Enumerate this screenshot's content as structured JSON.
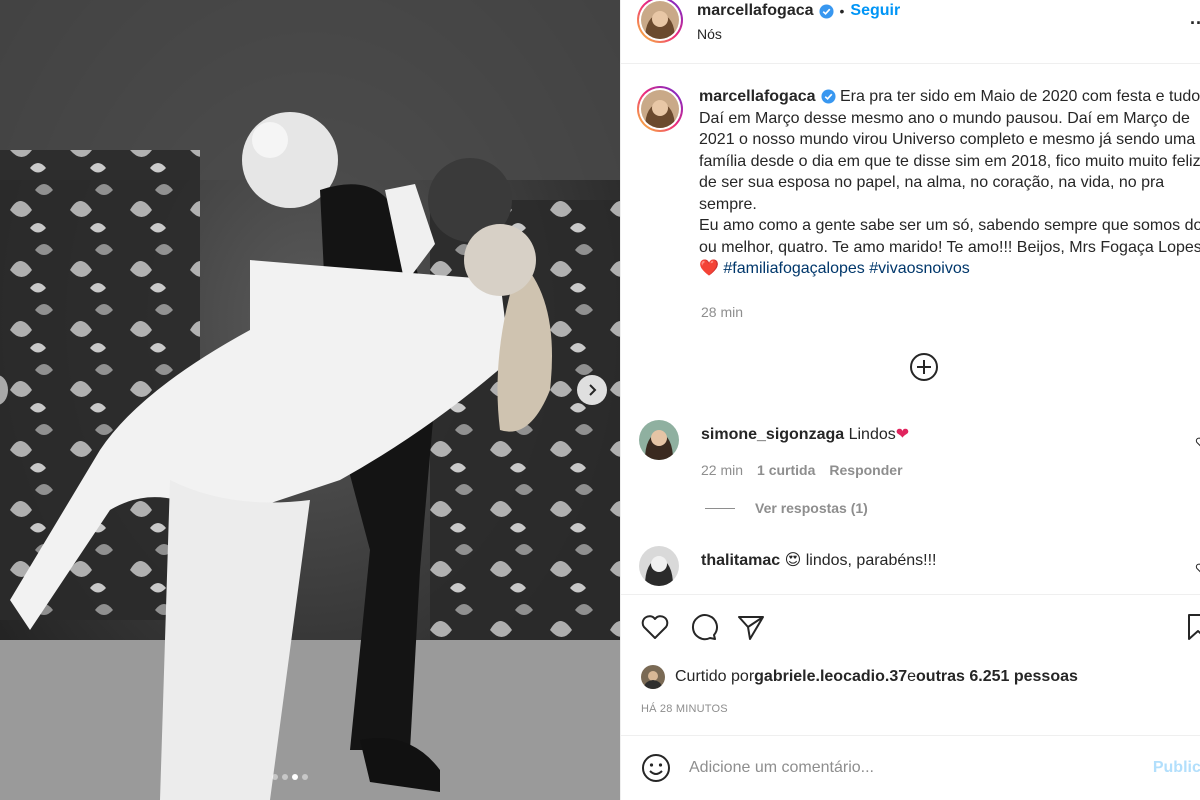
{
  "post": {
    "username": "marcellafogaca",
    "follow_label": "Seguir",
    "separator": "•",
    "location": "Nós",
    "more_label": "..."
  },
  "caption": {
    "username": "marcellafogaca",
    "text_part1": " Era pra ter sido em Maio de 2020 com festa e tudo. Daí em Março desse mesmo ano o mundo pausou. Daí em Março de 2021 o nosso mundo virou Universo completo e mesmo já sendo uma família desde o dia em que te disse sim em 2018, fico muito muito feliz de ser sua esposa no papel, na alma, no coração, na vida, no pra sempre.",
    "text_part2": "Eu amo como a gente sabe ser um só, sabendo sempre que somos dois, ou melhor, quatro. Te amo marido! Te amo!!! Beijos, Mrs Fogaça Lopes ",
    "heart": "❤️",
    "hashtag1": "#familiafogaçalopes",
    "hashtag2": "#vivaosnoivos",
    "time": "28 min"
  },
  "comments": [
    {
      "username": "simone_sigonzaga",
      "text": " Lindos",
      "emoji": "❤",
      "time": "22 min",
      "likes": "1 curtida",
      "reply": "Responder",
      "view_replies": "Ver respostas (1)"
    },
    {
      "username": "thalitamac",
      "emoji": "😍",
      "text": " lindos, parabéns!!!"
    }
  ],
  "likes": {
    "prefix": "Curtido por ",
    "user": "gabriele.leocadio.37",
    "middle": " e ",
    "others": "outras 6.251 pessoas"
  },
  "time_ago": "HÁ 28 MINUTOS",
  "add_comment": {
    "placeholder": "Adicione um comentário...",
    "publish": "Publicar"
  },
  "carousel": {
    "total": 4,
    "active": 3
  },
  "colors": {
    "accent": "#0095f6",
    "hashtag": "#00376b",
    "muted": "#8e8e8e",
    "heart": "#e0245e"
  },
  "icons": [
    "verified-icon",
    "like-icon",
    "comment-icon",
    "share-icon",
    "save-icon",
    "emoji-icon",
    "add-circle-icon",
    "chevron-right-icon",
    "heart-small-icon"
  ]
}
